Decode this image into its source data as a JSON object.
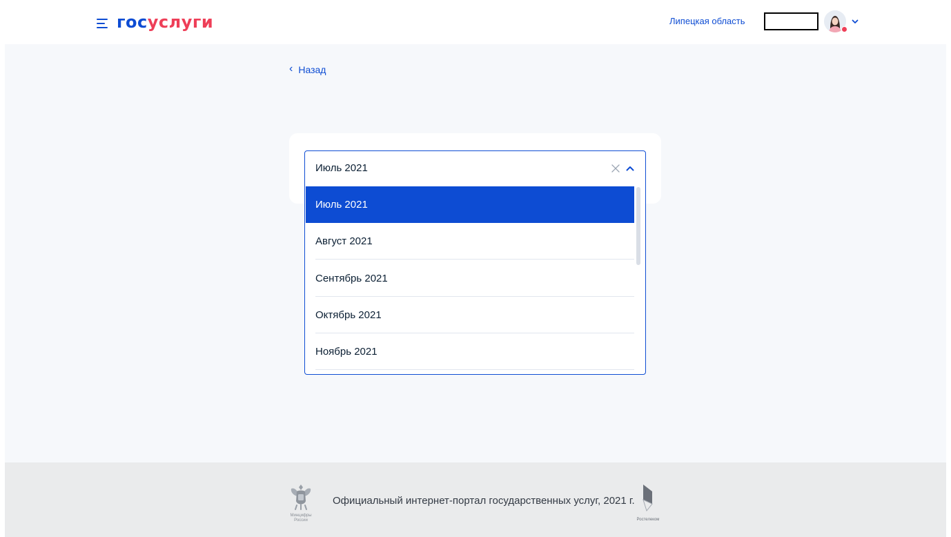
{
  "header": {
    "logo_part1": "гос",
    "logo_part2": "услуги",
    "region": "Липецкая область"
  },
  "back_link": {
    "label": "Назад"
  },
  "month_select": {
    "value": "Июль 2021",
    "options": [
      "Июль 2021",
      "Август 2021",
      "Сентябрь 2021",
      "Октябрь 2021",
      "Ноябрь 2021"
    ],
    "selected_index": 0
  },
  "footer": {
    "text": "Официальный интернет-портал государственных услуг, 2021 г.",
    "emblem_caption_line1": "Минцифры",
    "emblem_caption_line2": "России",
    "partner_caption": "Ростелеком"
  },
  "colors": {
    "accent": "#0d4cd3",
    "logo_red": "#ee3f58",
    "page_bg": "#f6f8fb",
    "footer_bg": "#eaebec"
  },
  "icons": {
    "menu": "burger-menu-icon",
    "clear": "close-icon",
    "collapse": "chevron-up-icon",
    "back": "chevron-left-icon",
    "user": "avatar-icon",
    "user_menu": "chevron-down-icon"
  }
}
